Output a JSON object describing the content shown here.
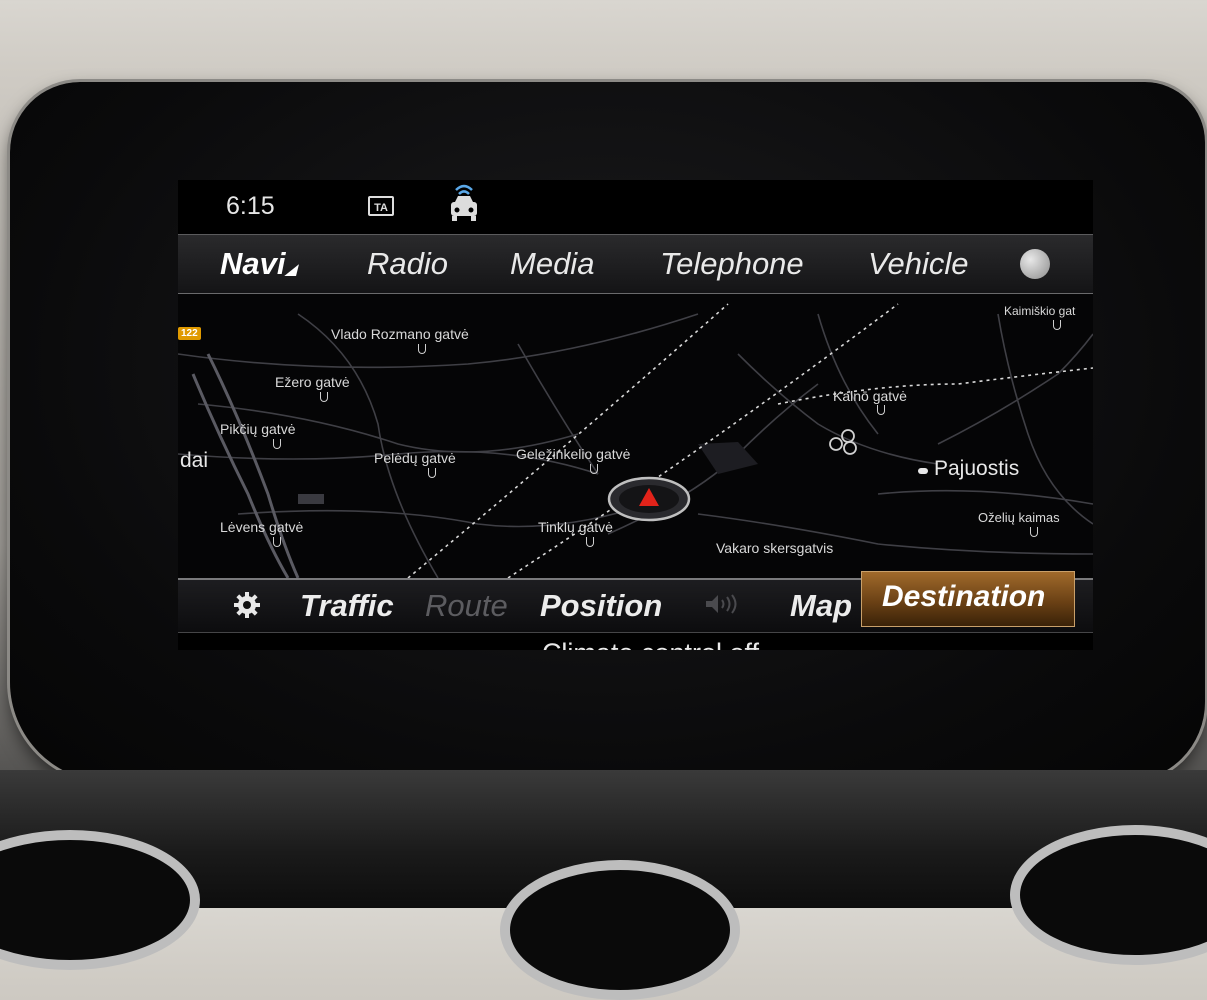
{
  "status_bar": {
    "time": "6:15",
    "ta_badge": "TA",
    "connected_car_icon": "connected-car-icon"
  },
  "top_nav": {
    "tabs": [
      {
        "label": "Navi",
        "active": true
      },
      {
        "label": "Radio"
      },
      {
        "label": "Media"
      },
      {
        "label": "Telephone"
      },
      {
        "label": "Vehicle"
      }
    ],
    "globe_icon": "globe-icon"
  },
  "map": {
    "road_sign": "122",
    "labels": {
      "vlado": "Vlado Rozmano gatvė",
      "ezero": "Ežero gatvė",
      "pikciu": "Pikčių gatvė",
      "dai": "dai",
      "peledu": "Pelėdų gatvė",
      "gelezinkelio": "Geležinkelio gatvė",
      "kalno": "Kalnō gatvė",
      "kaimiskio": "Kaimiškio gat",
      "pajuostis": "Pajuostis",
      "ozeliu": "Oželių kaimas",
      "levens": "Lėvens gatvė",
      "tinklu": "Tinklų gatvė",
      "vakaro": "Vakaro skersgatvis"
    }
  },
  "bottom_bar": {
    "traffic": "Traffic",
    "route": "Route",
    "position": "Position",
    "map": "Map",
    "destination": "Destination"
  },
  "status_message": "Climate control off",
  "colors": {
    "accent": "#a06a2b",
    "road_sign": "#e09a00",
    "vehicle_arrow": "#e2231a",
    "car_icon": "#5aa8e8"
  }
}
